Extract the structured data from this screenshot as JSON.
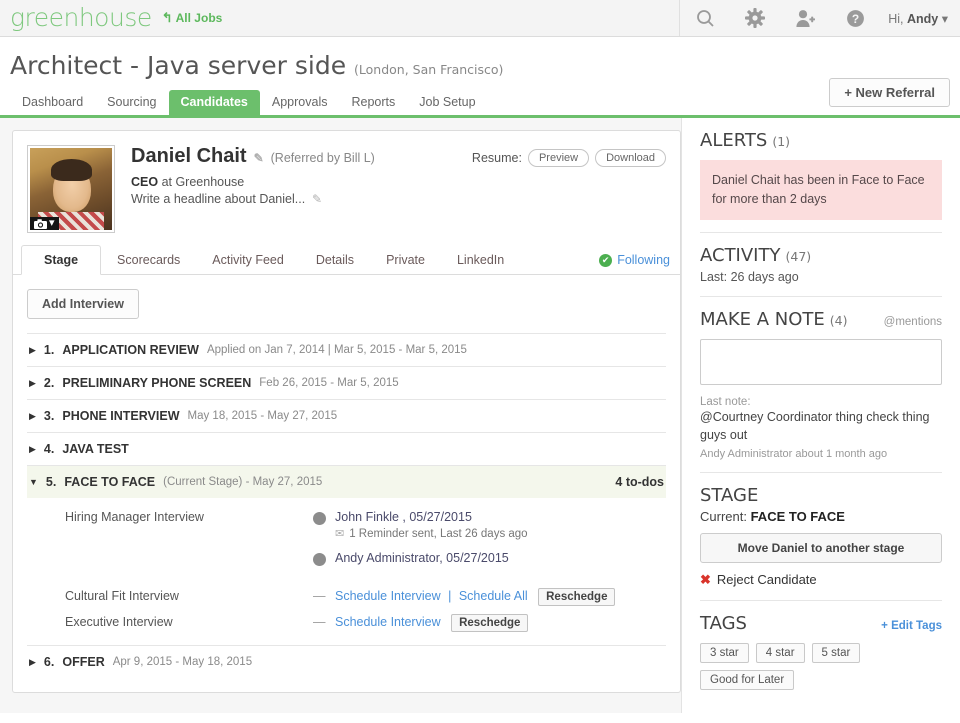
{
  "brand": {
    "logo_text": "greenhouse",
    "all_jobs": "All Jobs",
    "accent_green": "#6cbf6c",
    "link_blue": "#4a90d9",
    "alert_pink": "#fbdddd"
  },
  "topbar": {
    "icons": [
      "search-icon",
      "gear-icon",
      "add-user-icon",
      "help-icon"
    ],
    "greeting_prefix": "Hi, ",
    "user_name": "Andy",
    "caret": "▾"
  },
  "job": {
    "title": "Architect - Java server side",
    "locations": "(London, San Francisco)",
    "new_referral": "+ New Referral",
    "nav": [
      {
        "label": "Dashboard",
        "active": false
      },
      {
        "label": "Sourcing",
        "active": false
      },
      {
        "label": "Candidates",
        "active": true
      },
      {
        "label": "Approvals",
        "active": false
      },
      {
        "label": "Reports",
        "active": false
      },
      {
        "label": "Job Setup",
        "active": false
      }
    ]
  },
  "candidate": {
    "name": "Daniel Chait",
    "referred_by": "(Referred by Bill L)",
    "title_bold": "CEO",
    "title_rest": " at Greenhouse",
    "headline_placeholder": "Write a headline about Daniel...",
    "resume_label": "Resume:",
    "resume_preview": "Preview",
    "resume_download": "Download",
    "camera_label": "▾"
  },
  "card_tabs": [
    {
      "label": "Stage",
      "active": true
    },
    {
      "label": "Scorecards",
      "active": false
    },
    {
      "label": "Activity Feed",
      "active": false
    },
    {
      "label": "Details",
      "active": false
    },
    {
      "label": "Private",
      "active": false
    },
    {
      "label": "LinkedIn",
      "active": false
    }
  ],
  "following_label": "Following",
  "add_interview_label": "Add Interview",
  "stages": [
    {
      "num": "1.",
      "name": "APPLICATION REVIEW",
      "meta": "Applied on Jan 7, 2014  |  Mar 5, 2015 - Mar 5, 2015",
      "expanded": false,
      "todos": ""
    },
    {
      "num": "2.",
      "name": "PRELIMINARY PHONE SCREEN",
      "meta": "Feb 26, 2015 - Mar 5, 2015",
      "expanded": false,
      "todos": ""
    },
    {
      "num": "3.",
      "name": "PHONE INTERVIEW",
      "meta": "May 18, 2015 - May 27, 2015",
      "expanded": false,
      "todos": ""
    },
    {
      "num": "4.",
      "name": "JAVA TEST",
      "meta": "",
      "expanded": false,
      "todos": ""
    },
    {
      "num": "5.",
      "name": "FACE TO FACE",
      "meta": "(Current Stage) - May 27, 2015",
      "expanded": true,
      "todos": "4 to-dos"
    },
    {
      "num": "6.",
      "name": "OFFER",
      "meta": "Apr 9, 2015 - May 18, 2015",
      "expanded": false,
      "todos": ""
    }
  ],
  "interviews": [
    {
      "name": "Hiring Manager Interview",
      "kind": "scheduled",
      "people": [
        {
          "name": "John Finkle , 05/27/2015",
          "sub": "1 Reminder sent, Last 26 days ago"
        },
        {
          "name": "Andy Administrator, 05/27/2015",
          "sub": ""
        }
      ]
    },
    {
      "name": "Cultural Fit Interview",
      "kind": "unscheduled",
      "dash": "—",
      "schedule": "Schedule Interview",
      "separator": "|",
      "schedule_all": "Schedule All",
      "reschedule": "Reschedge"
    },
    {
      "name": "Executive Interview",
      "kind": "unscheduled",
      "dash": "—",
      "schedule": "Schedule Interview",
      "separator": "",
      "schedule_all": "",
      "reschedule": "Reschedge"
    }
  ],
  "sidebar": {
    "alerts": {
      "title": "ALERTS",
      "count": "(1)",
      "message": "Daniel Chait has been in Face to Face for more than 2 days"
    },
    "activity": {
      "title": "ACTIVITY",
      "count": "(47)",
      "last": "Last: 26 days ago"
    },
    "note": {
      "title": "MAKE A NOTE",
      "count": "(4)",
      "mentions": "@mentions",
      "input_value": "",
      "input_placeholder": "",
      "last_note_label": "Last note:",
      "last_note_text": "@Courtney Coordinator thing check thing guys out",
      "last_note_meta": "Andy Administrator about 1 month ago"
    },
    "stage": {
      "title": "STAGE",
      "current_label": "Current: ",
      "current_value": "FACE TO FACE",
      "move_button": "Move Daniel to another stage",
      "reject": "Reject Candidate"
    },
    "tags": {
      "title": "TAGS",
      "edit": "+ Edit Tags",
      "items": [
        "3 star",
        "4 star",
        "5 star",
        "Good for Later"
      ]
    }
  }
}
